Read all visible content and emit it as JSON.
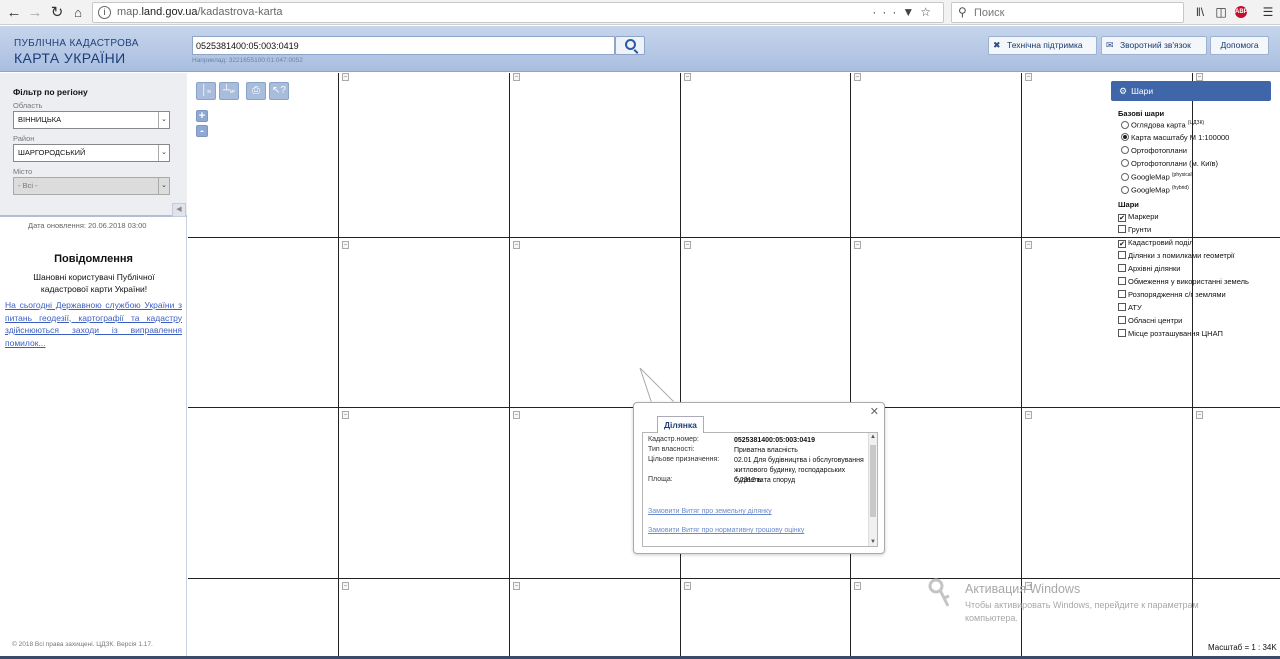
{
  "browser": {
    "url_prefix": "map.",
    "url_host": "land.gov.ua",
    "url_path": "/kadastrova-karta",
    "search_placeholder": "Поиск",
    "abp_label": "ABP"
  },
  "header": {
    "logo_line1": "ПУБЛІЧНА КАДАСТРОВА",
    "logo_line2": "КАРТА УКРАЇНИ",
    "cadastral_input": "0525381400:05:003:0419",
    "example": "Наприклад: 3221655100:01:047:0052",
    "buttons": {
      "support": "Технічна підтримка",
      "feedback": "Зворотний зв'язок",
      "help": "Допомога"
    }
  },
  "sidebar": {
    "filter_title": "Фільтр по регіону",
    "oblast_label": "Область",
    "oblast_value": "ВІННИЦЬКА",
    "rayon_label": "Район",
    "rayon_value": "ШАРГОРОДСЬКИЙ",
    "city_label": "Місто",
    "city_value": "- Всі -",
    "updated": "Дата оновлення: 20.06.2018 03:00",
    "notice_title": "Повідомлення",
    "notice_text": "Шановні користувачі Публічної кадастрової карти України!",
    "notice_link": "На сьогодні Державною службою України з питань геодезії, картографії та кадастру здійснюються заходи із виправлення помилок...",
    "copyright": "© 2018 Всі права захищені. ЦДЗК. Версія 1.17."
  },
  "map": {
    "zoom_in": "+",
    "zoom_out": "-",
    "scale": "Масштаб = 1 : 34K"
  },
  "layers": {
    "title": "Шари",
    "base_title": "Базові шари",
    "base": [
      {
        "label": "Оглядова карта",
        "sup": "(ЦДЗК)",
        "checked": false
      },
      {
        "label": "Карта масштабу М 1:100000",
        "sup": "",
        "checked": true
      },
      {
        "label": "Ортофотоплани",
        "sup": "",
        "checked": false
      },
      {
        "label": "Ортофотоплани (м. Київ)",
        "sup": "",
        "checked": false
      },
      {
        "label": "GoogleMap",
        "sup": "(physical)",
        "checked": false
      },
      {
        "label": "GoogleMap",
        "sup": "(hybrid)",
        "checked": false
      }
    ],
    "layers_title": "Шари",
    "items": [
      {
        "label": "Маркери",
        "checked": true
      },
      {
        "label": "Грунти",
        "checked": false
      },
      {
        "label": "Кадастровий поділ",
        "checked": true
      },
      {
        "label": "Ділянки з помилками геометрії",
        "checked": false
      },
      {
        "label": "Архівні ділянки",
        "checked": false
      },
      {
        "label": "Обмеження у використанні земель",
        "checked": false
      },
      {
        "label": "Розпорядження с/г землями",
        "checked": false
      },
      {
        "label": "АТУ",
        "checked": false
      },
      {
        "label": "Обласні центри",
        "checked": false
      },
      {
        "label": "Місце розташування ЦНАП",
        "checked": false
      }
    ]
  },
  "popup": {
    "tab": "Ділянка",
    "rows": [
      {
        "key": "Кадастр.номер:",
        "value": "0525381400:05:003:0419",
        "bold": true
      },
      {
        "key": "Тип власності:",
        "value": "Приватна власність",
        "bold": false
      },
      {
        "key": "Цільове призначення:",
        "value": "02.01 Для будівництва і обслуговування житлового будинку, господарських будівель та споруд",
        "bold": false
      },
      {
        "key": "Площа:",
        "value": "0.2312 га",
        "bold": false
      }
    ],
    "link1": "Замовити Витяг про земельну ділянку",
    "link2": "Замовити Витяг про нормативну грошову оцінку"
  },
  "watermark": {
    "title": "Активация Windows",
    "text": "Чтобы активировать Windows, перейдите к параметрам компьютера."
  }
}
